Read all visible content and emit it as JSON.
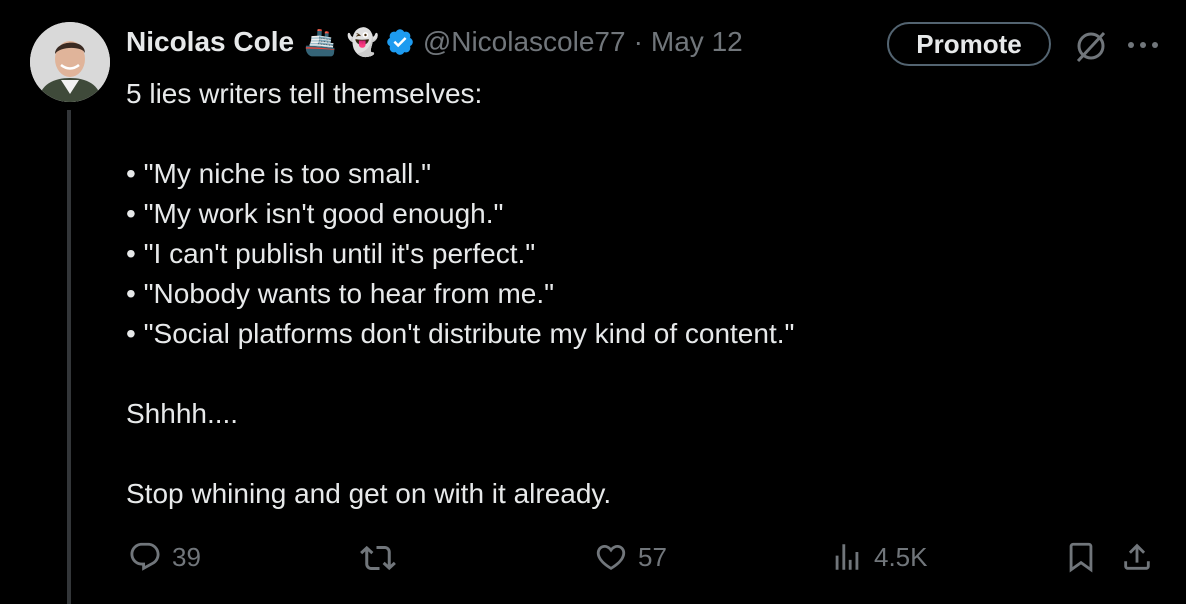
{
  "author": {
    "name": "Nicolas Cole",
    "emojis": [
      "🚢",
      "👻"
    ],
    "handle": "@Nicolascole77",
    "separator": "·",
    "date": "May 12"
  },
  "header_actions": {
    "promote_label": "Promote",
    "grok_icon": "grok-icon",
    "more_icon": "more-icon"
  },
  "tweet": {
    "lines": [
      "5 lies writers tell themselves:",
      "",
      "• \"My niche is too small.\"",
      "• \"My work isn't good enough.\"",
      "• \"I can't publish until it's perfect.\"",
      "• \"Nobody wants to hear from me.\"",
      "• \"Social platforms don't distribute my kind of content.\"",
      "",
      "Shhhh....",
      "",
      "Stop whining and get on with it already."
    ]
  },
  "actions": {
    "replies": "39",
    "retweets": "",
    "likes": "57",
    "views": "4.5K"
  },
  "colors": {
    "background": "#000000",
    "text": "#e7e9ea",
    "muted": "#71767b",
    "verified": "#1d9bf0",
    "border": "#536471"
  }
}
